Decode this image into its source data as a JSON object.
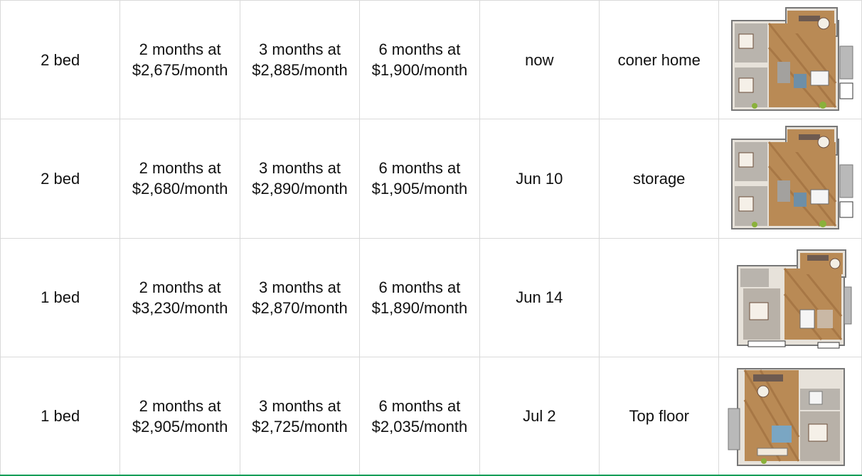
{
  "rows": [
    {
      "beds": "2 bed",
      "price_2_period": "2 months at",
      "price_2_amount": "$2,675/month",
      "price_3_period": "3 months at",
      "price_3_amount": "$2,885/month",
      "price_6_period": "6 months at",
      "price_6_amount": "$1,900/month",
      "available": "now",
      "note": "coner home",
      "floorplan": "two-bedroom-floorplan"
    },
    {
      "beds": "2 bed",
      "price_2_period": "2 months at",
      "price_2_amount": "$2,680/month",
      "price_3_period": "3 months at",
      "price_3_amount": "$2,890/month",
      "price_6_period": "6 months at",
      "price_6_amount": "$1,905/month",
      "available": "Jun 10",
      "note": "storage",
      "floorplan": "two-bedroom-floorplan"
    },
    {
      "beds": "1 bed",
      "price_2_period": "2 months at",
      "price_2_amount": "$3,230/month",
      "price_3_period": "3 months at",
      "price_3_amount": "$2,870/month",
      "price_6_period": "6 months at",
      "price_6_amount": "$1,890/month",
      "available": "Jun 14",
      "note": "",
      "floorplan": "one-bedroom-floorplan-a"
    },
    {
      "beds": "1 bed",
      "price_2_period": "2 months at",
      "price_2_amount": "$2,905/month",
      "price_3_period": "3 months at",
      "price_3_amount": "$2,725/month",
      "price_6_period": "6 months at",
      "price_6_amount": "$2,035/month",
      "available": "Jul 2",
      "note": "Top floor",
      "floorplan": "one-bedroom-floorplan-b"
    }
  ],
  "colors": {
    "grid_line": "#d9d9d9",
    "selection_bottom": "#0f9d58",
    "floor_wood": "#b98a55",
    "floor_tile": "#8d8d8d",
    "wall": "#e7e2da"
  }
}
